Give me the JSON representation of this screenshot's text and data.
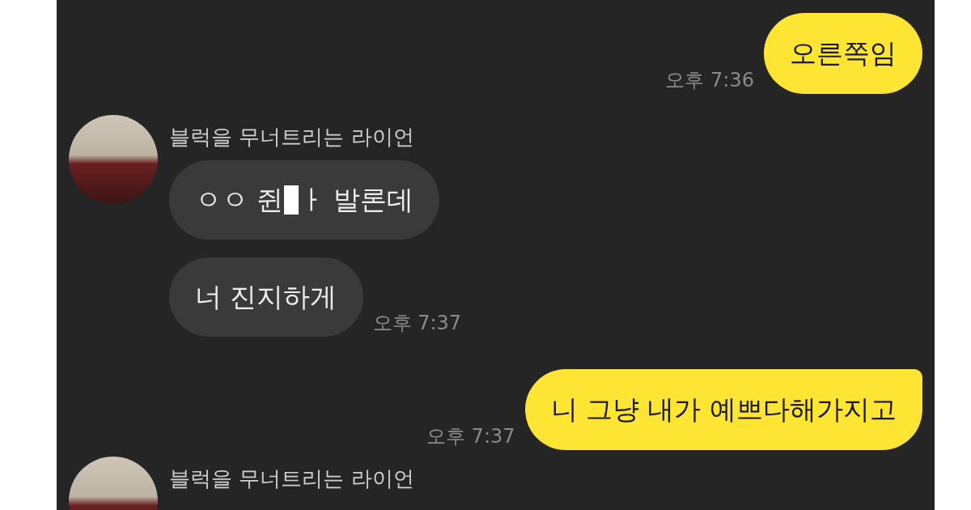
{
  "chat": {
    "items": [
      {
        "kind": "sent",
        "text": "오른쪽임",
        "time": "오후 7:36",
        "tail": false
      },
      {
        "kind": "received",
        "sender": "블럭을 무너트리는 라이언",
        "bubbles": [
          {
            "parts": [
              "ㅇㅇ 쥔",
              "ㅏ 발론데"
            ]
          },
          {
            "parts": [
              "너 진지하게"
            ],
            "time": "오후 7:37"
          }
        ]
      },
      {
        "kind": "sent",
        "text": "니 그냥 내가 예쁘다해가지고",
        "time": "오후 7:37",
        "tail": true
      },
      {
        "kind": "received",
        "sender": "블럭을 무너트리는 라이언"
      }
    ]
  }
}
